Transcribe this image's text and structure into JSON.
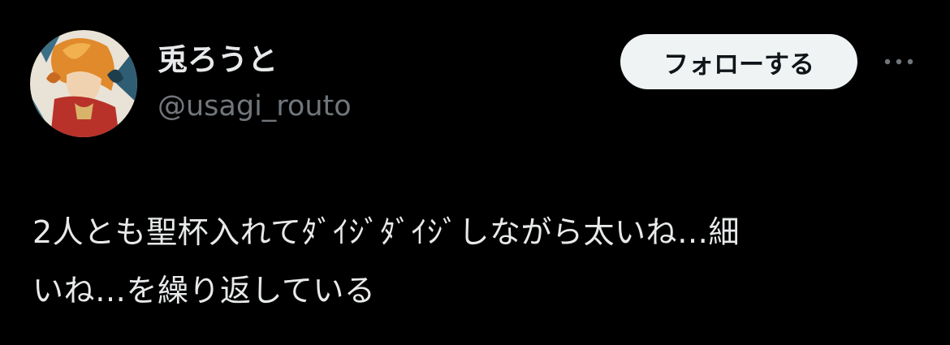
{
  "user": {
    "display_name": "兎ろうと",
    "handle": "@usagi_routo",
    "avatar_icon": "avatar-image"
  },
  "actions": {
    "follow_label": "フォローする",
    "more_icon": "more-horizontal-icon"
  },
  "tweet": {
    "lines": [
      "2人とも聖杯入れてﾀﾞｲｼﾞﾀﾞｲｼﾞしながら太いね…細",
      "いね…を繰り返している"
    ]
  },
  "colors": {
    "background": "#000000",
    "primary_text": "#e7e9ea",
    "secondary_text": "#71767b",
    "follow_button_bg": "#eff3f4",
    "follow_button_text": "#0f1419"
  }
}
